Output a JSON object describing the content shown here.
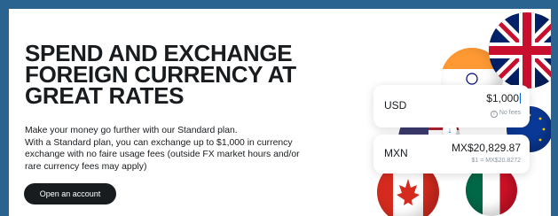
{
  "hero": {
    "headline": "SPEND AND EXCHANGE FOREIGN CURRENCY AT GREAT RATES",
    "description_line1": "Make your money go further with our Standard plan.",
    "description_line2": "With a Standard plan, you can exchange up to $1,000 in currency exchange with no faire usage fees (outside FX market hours and/or rare currency fees may apply)",
    "cta_label": "Open an account"
  },
  "exchange_widget": {
    "from": {
      "code": "USD",
      "amount": "$1,000",
      "note": "No fees"
    },
    "to": {
      "code": "MXN",
      "amount": "MX$20,829.87",
      "rate": "$1 = MX$20.8272"
    }
  },
  "colors": {
    "page_background": "#2b6390",
    "text": "#191c1f",
    "button": "#191c1f",
    "accent": "#0666eb"
  },
  "icons": {
    "info": "info-icon",
    "swap": "arrow-down-icon"
  }
}
